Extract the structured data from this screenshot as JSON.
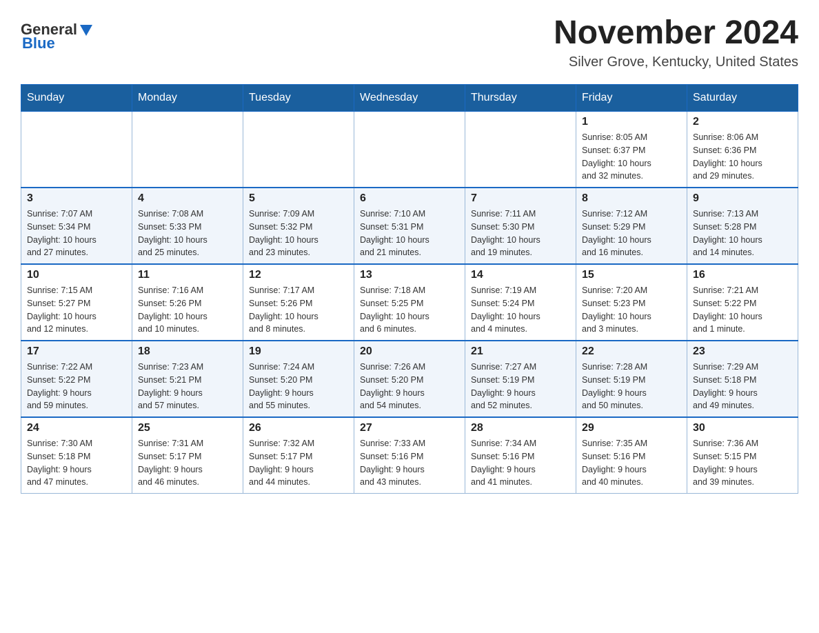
{
  "header": {
    "logo_general": "General",
    "logo_blue": "Blue",
    "title": "November 2024",
    "subtitle": "Silver Grove, Kentucky, United States"
  },
  "weekdays": [
    "Sunday",
    "Monday",
    "Tuesday",
    "Wednesday",
    "Thursday",
    "Friday",
    "Saturday"
  ],
  "weeks": [
    [
      {
        "day": "",
        "info": ""
      },
      {
        "day": "",
        "info": ""
      },
      {
        "day": "",
        "info": ""
      },
      {
        "day": "",
        "info": ""
      },
      {
        "day": "",
        "info": ""
      },
      {
        "day": "1",
        "info": "Sunrise: 8:05 AM\nSunset: 6:37 PM\nDaylight: 10 hours\nand 32 minutes."
      },
      {
        "day": "2",
        "info": "Sunrise: 8:06 AM\nSunset: 6:36 PM\nDaylight: 10 hours\nand 29 minutes."
      }
    ],
    [
      {
        "day": "3",
        "info": "Sunrise: 7:07 AM\nSunset: 5:34 PM\nDaylight: 10 hours\nand 27 minutes."
      },
      {
        "day": "4",
        "info": "Sunrise: 7:08 AM\nSunset: 5:33 PM\nDaylight: 10 hours\nand 25 minutes."
      },
      {
        "day": "5",
        "info": "Sunrise: 7:09 AM\nSunset: 5:32 PM\nDaylight: 10 hours\nand 23 minutes."
      },
      {
        "day": "6",
        "info": "Sunrise: 7:10 AM\nSunset: 5:31 PM\nDaylight: 10 hours\nand 21 minutes."
      },
      {
        "day": "7",
        "info": "Sunrise: 7:11 AM\nSunset: 5:30 PM\nDaylight: 10 hours\nand 19 minutes."
      },
      {
        "day": "8",
        "info": "Sunrise: 7:12 AM\nSunset: 5:29 PM\nDaylight: 10 hours\nand 16 minutes."
      },
      {
        "day": "9",
        "info": "Sunrise: 7:13 AM\nSunset: 5:28 PM\nDaylight: 10 hours\nand 14 minutes."
      }
    ],
    [
      {
        "day": "10",
        "info": "Sunrise: 7:15 AM\nSunset: 5:27 PM\nDaylight: 10 hours\nand 12 minutes."
      },
      {
        "day": "11",
        "info": "Sunrise: 7:16 AM\nSunset: 5:26 PM\nDaylight: 10 hours\nand 10 minutes."
      },
      {
        "day": "12",
        "info": "Sunrise: 7:17 AM\nSunset: 5:26 PM\nDaylight: 10 hours\nand 8 minutes."
      },
      {
        "day": "13",
        "info": "Sunrise: 7:18 AM\nSunset: 5:25 PM\nDaylight: 10 hours\nand 6 minutes."
      },
      {
        "day": "14",
        "info": "Sunrise: 7:19 AM\nSunset: 5:24 PM\nDaylight: 10 hours\nand 4 minutes."
      },
      {
        "day": "15",
        "info": "Sunrise: 7:20 AM\nSunset: 5:23 PM\nDaylight: 10 hours\nand 3 minutes."
      },
      {
        "day": "16",
        "info": "Sunrise: 7:21 AM\nSunset: 5:22 PM\nDaylight: 10 hours\nand 1 minute."
      }
    ],
    [
      {
        "day": "17",
        "info": "Sunrise: 7:22 AM\nSunset: 5:22 PM\nDaylight: 9 hours\nand 59 minutes."
      },
      {
        "day": "18",
        "info": "Sunrise: 7:23 AM\nSunset: 5:21 PM\nDaylight: 9 hours\nand 57 minutes."
      },
      {
        "day": "19",
        "info": "Sunrise: 7:24 AM\nSunset: 5:20 PM\nDaylight: 9 hours\nand 55 minutes."
      },
      {
        "day": "20",
        "info": "Sunrise: 7:26 AM\nSunset: 5:20 PM\nDaylight: 9 hours\nand 54 minutes."
      },
      {
        "day": "21",
        "info": "Sunrise: 7:27 AM\nSunset: 5:19 PM\nDaylight: 9 hours\nand 52 minutes."
      },
      {
        "day": "22",
        "info": "Sunrise: 7:28 AM\nSunset: 5:19 PM\nDaylight: 9 hours\nand 50 minutes."
      },
      {
        "day": "23",
        "info": "Sunrise: 7:29 AM\nSunset: 5:18 PM\nDaylight: 9 hours\nand 49 minutes."
      }
    ],
    [
      {
        "day": "24",
        "info": "Sunrise: 7:30 AM\nSunset: 5:18 PM\nDaylight: 9 hours\nand 47 minutes."
      },
      {
        "day": "25",
        "info": "Sunrise: 7:31 AM\nSunset: 5:17 PM\nDaylight: 9 hours\nand 46 minutes."
      },
      {
        "day": "26",
        "info": "Sunrise: 7:32 AM\nSunset: 5:17 PM\nDaylight: 9 hours\nand 44 minutes."
      },
      {
        "day": "27",
        "info": "Sunrise: 7:33 AM\nSunset: 5:16 PM\nDaylight: 9 hours\nand 43 minutes."
      },
      {
        "day": "28",
        "info": "Sunrise: 7:34 AM\nSunset: 5:16 PM\nDaylight: 9 hours\nand 41 minutes."
      },
      {
        "day": "29",
        "info": "Sunrise: 7:35 AM\nSunset: 5:16 PM\nDaylight: 9 hours\nand 40 minutes."
      },
      {
        "day": "30",
        "info": "Sunrise: 7:36 AM\nSunset: 5:15 PM\nDaylight: 9 hours\nand 39 minutes."
      }
    ]
  ]
}
